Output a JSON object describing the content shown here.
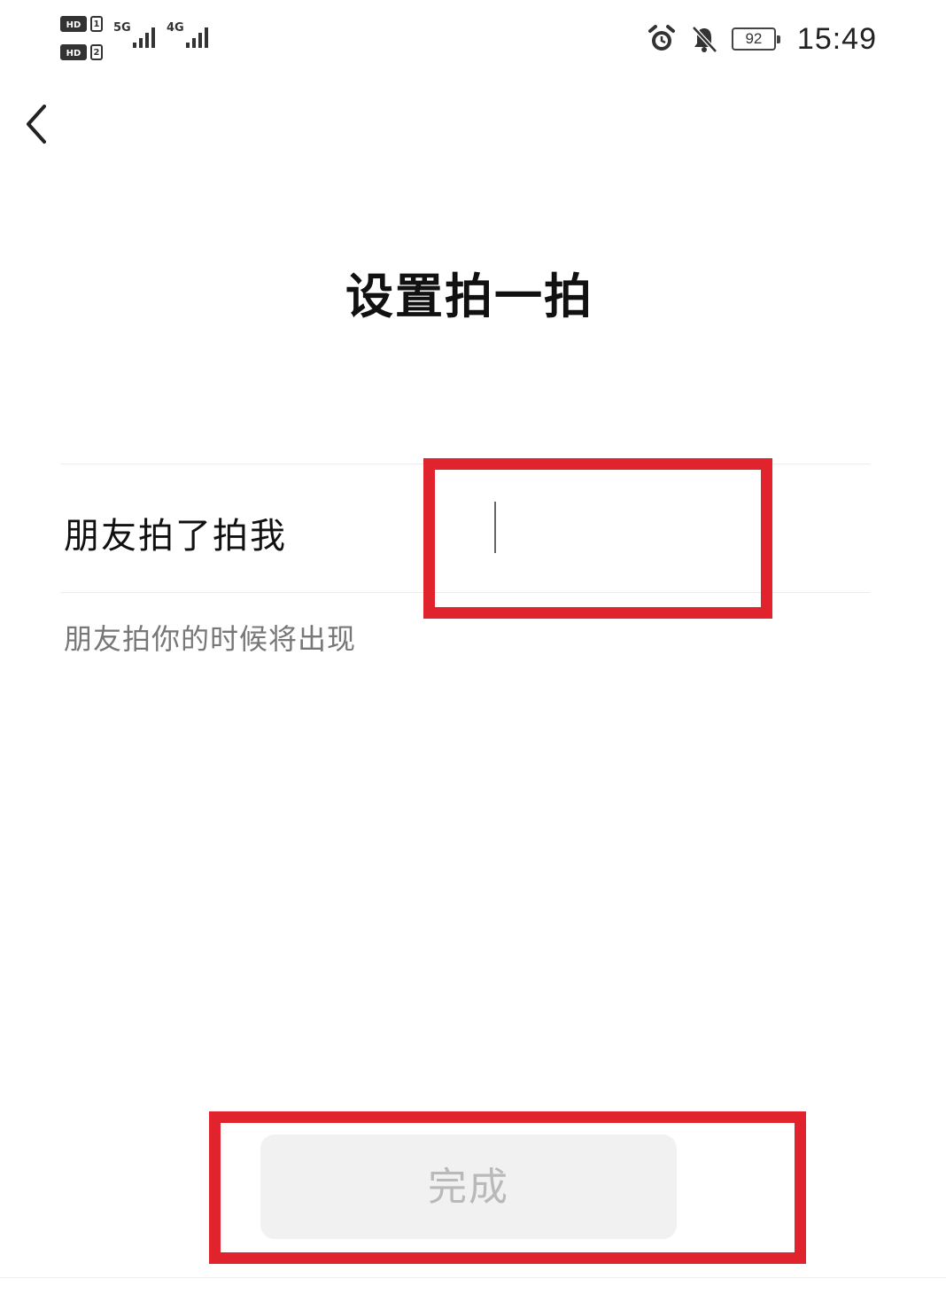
{
  "status_bar": {
    "sim1_badge": "HD",
    "sim1_number": "1",
    "sim2_badge": "HD",
    "sim2_number": "2",
    "network_1": "5G",
    "network_2": "4G",
    "battery_level": "92",
    "time": "15:49",
    "icons": [
      "alarm-icon",
      "mute-bell-icon",
      "battery-icon"
    ]
  },
  "nav": {
    "back_icon": "chevron-left-icon"
  },
  "page": {
    "title": "设置拍一拍"
  },
  "pat_field": {
    "label": "朋友拍了拍我",
    "value": "",
    "placeholder": "",
    "hint": "朋友拍你的时候将出现"
  },
  "footer": {
    "done_label": "完成",
    "done_enabled": false
  },
  "colors": {
    "highlight": "#e0232d",
    "button_bg_disabled": "#f1f1f1",
    "button_text_disabled": "#b9b9b9",
    "hint_text": "#777777"
  }
}
